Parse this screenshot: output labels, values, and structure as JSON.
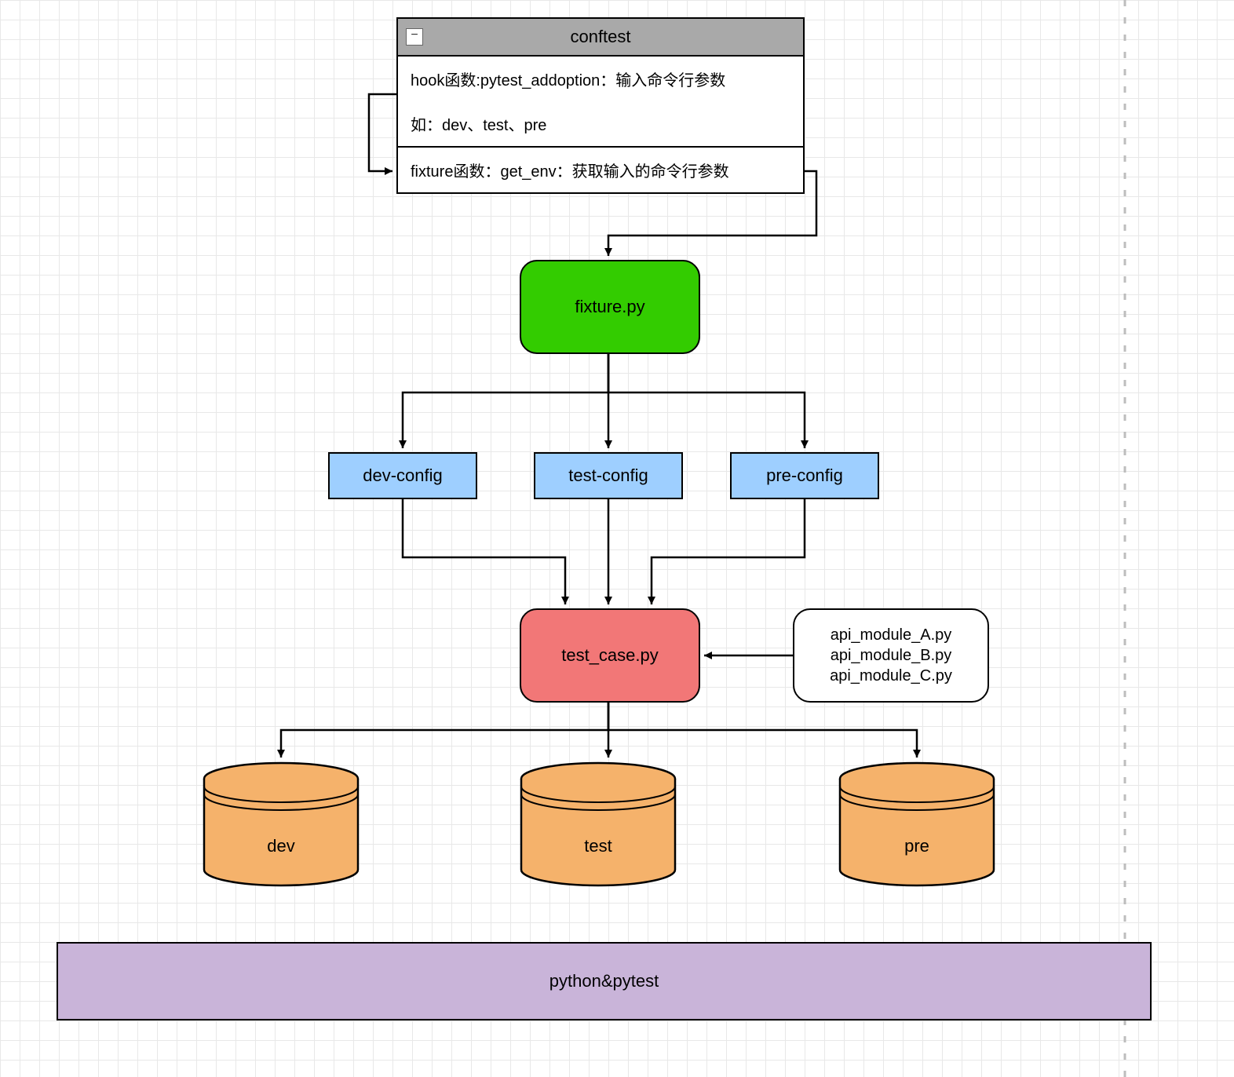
{
  "conftest": {
    "title": "conftest",
    "row1": "hook函数:pytest_addoption：输入命令行参数",
    "row2": "如：dev、test、pre",
    "row3": "fixture函数：get_env：获取输入的命令行参数"
  },
  "fixture": {
    "label": "fixture.py"
  },
  "configs": {
    "dev": {
      "label": "dev-config"
    },
    "test": {
      "label": "test-config"
    },
    "pre": {
      "label": "pre-config"
    }
  },
  "testcase": {
    "label": "test_case.py"
  },
  "api_modules": {
    "line1": "api_module_A.py",
    "line2": "api_module_B.py",
    "line3": "api_module_C.py"
  },
  "databases": {
    "dev": {
      "label": "dev"
    },
    "test": {
      "label": "test"
    },
    "pre": {
      "label": "pre"
    }
  },
  "footer": {
    "label": "python&pytest"
  },
  "collapse_glyph": "−"
}
